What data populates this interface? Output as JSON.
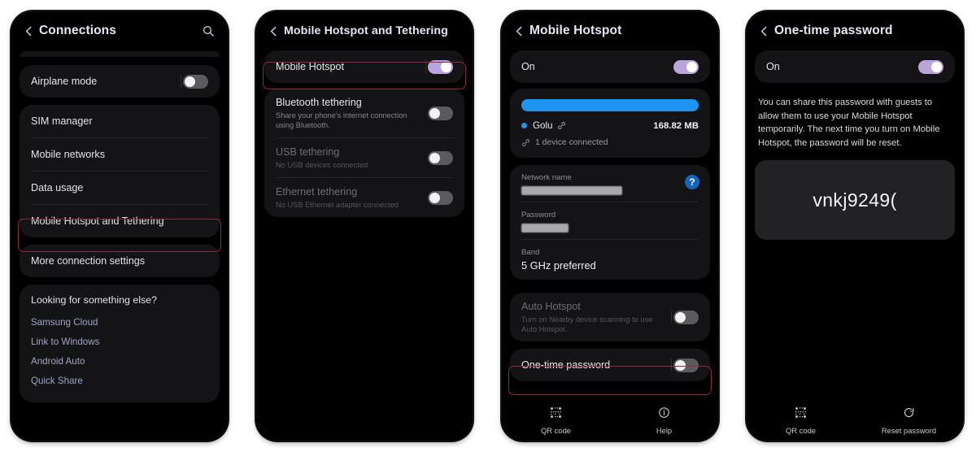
{
  "theme": {
    "page_background": "#ffffff",
    "screen_background": "#000000",
    "card_background": "#141416",
    "accent_toggle_on": "#b9a4dc",
    "accent_progress": "#1c95f0",
    "accent_help_badge": "#1466bb",
    "highlight_outline": "#93293b",
    "link_color": "#9fa4c4"
  },
  "panel1": {
    "header": {
      "title": "Connections",
      "back_icon": "chevron-left-icon",
      "search_icon": "search-icon"
    },
    "airplane": {
      "label": "Airplane mode",
      "toggle_state": "off"
    },
    "menu_items": [
      {
        "label": "SIM manager"
      },
      {
        "label": "Mobile networks"
      },
      {
        "label": "Data usage"
      },
      {
        "label": "Mobile Hotspot and Tethering",
        "highlighted": true
      }
    ],
    "more_settings": {
      "label": "More connection settings"
    },
    "looking": {
      "title": "Looking for something else?",
      "links": [
        {
          "label": "Samsung Cloud"
        },
        {
          "label": "Link to Windows"
        },
        {
          "label": "Android Auto"
        },
        {
          "label": "Quick Share"
        }
      ]
    }
  },
  "panel2": {
    "header": {
      "title": "Mobile Hotspot and Tethering",
      "back_icon": "chevron-left-icon"
    },
    "rows": [
      {
        "label": "Mobile Hotspot",
        "sub": "",
        "toggle_state": "on",
        "disabled": false,
        "highlighted": true
      },
      {
        "label": "Bluetooth tethering",
        "sub": "Share your phone's internet connection using Bluetooth.",
        "toggle_state": "off",
        "disabled": false,
        "highlighted": false
      },
      {
        "label": "USB tethering",
        "sub": "No USB devices connected",
        "toggle_state": "off",
        "disabled": true,
        "highlighted": false
      },
      {
        "label": "Ethernet tethering",
        "sub": "No USB Ethernet adapter connected",
        "toggle_state": "off",
        "disabled": true,
        "highlighted": false
      }
    ]
  },
  "panel3": {
    "header": {
      "title": "Mobile Hotspot",
      "back_icon": "chevron-left-icon"
    },
    "master": {
      "label": "On",
      "toggle_state": "on"
    },
    "usage": {
      "progress_percent": 100,
      "device_name": "Golu",
      "device_icon": "link-chain-icon",
      "data_used": "168.82 MB",
      "connected_text": "1 device connected"
    },
    "fields": [
      {
        "label": "Network name",
        "value": "",
        "redacted": true,
        "redact_width": "w1",
        "help_icon": "question-mark-icon"
      },
      {
        "label": "Password",
        "value": "",
        "redacted": true,
        "redact_width": "w2"
      },
      {
        "label": "Band",
        "value": "5 GHz preferred",
        "redacted": false
      }
    ],
    "auto_hotspot": {
      "label": "Auto Hotspot",
      "sub": "Turn on Nearby device scanning to use Auto Hotspot.",
      "toggle_state": "off",
      "disabled": true
    },
    "one_time_password": {
      "label": "One-time password",
      "toggle_state": "off",
      "highlighted": true
    },
    "bottom_bar": [
      {
        "label": "QR code",
        "icon": "qr-code-icon"
      },
      {
        "label": "Help",
        "icon": "info-circle-icon"
      }
    ]
  },
  "panel4": {
    "header": {
      "title": "One-time password",
      "back_icon": "chevron-left-icon"
    },
    "master": {
      "label": "On",
      "toggle_state": "on"
    },
    "description": "You can share this password with guests to allow them to use your Mobile Hotspot temporarily. The next time you turn on Mobile Hotspot, the password will be reset.",
    "password": "vnkj9249(",
    "bottom_bar": [
      {
        "label": "QR code",
        "icon": "qr-code-icon"
      },
      {
        "label": "Reset password",
        "icon": "reset-rotate-icon"
      }
    ]
  }
}
